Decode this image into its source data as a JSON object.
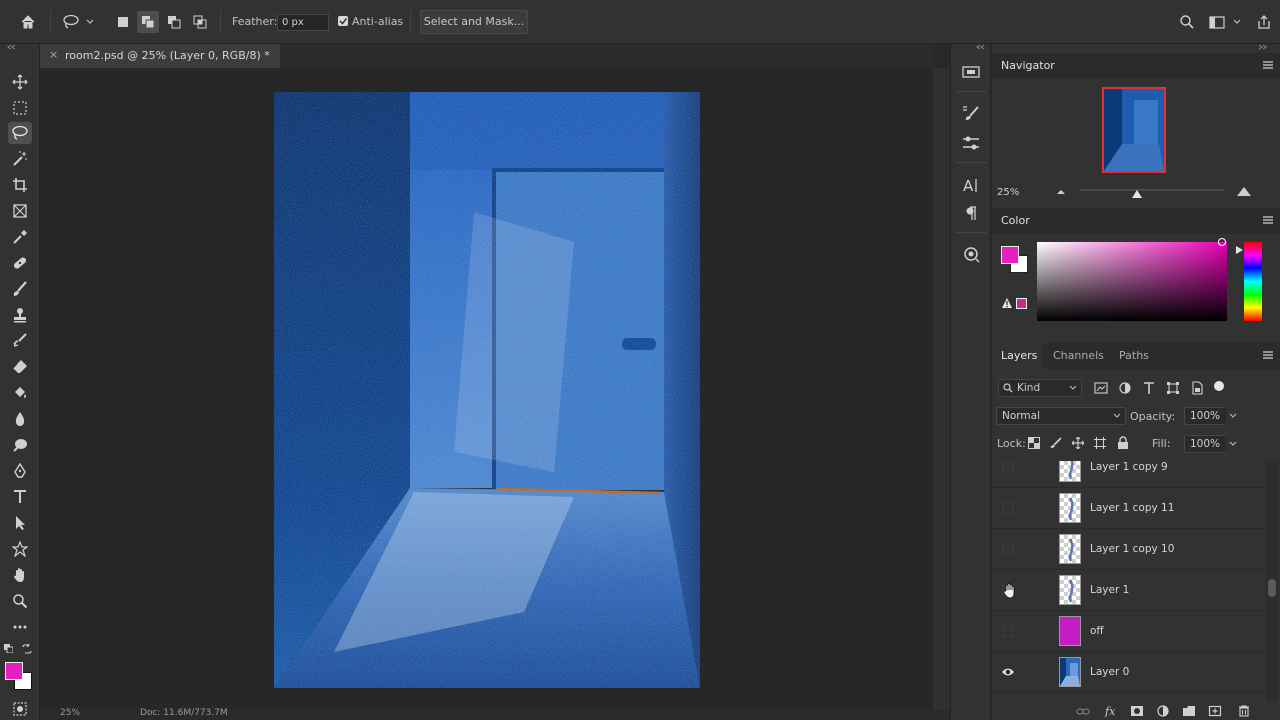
{
  "options_bar": {
    "feather_label": "Feather:",
    "feather_value": "0 px",
    "antialias_label": "Anti-alias",
    "select_mask_label": "Select and Mask..."
  },
  "document": {
    "tab_title": "room2.psd @ 25% (Layer 0, RGB/8) *",
    "close_glyph": "×",
    "status_zoom": "25%",
    "status_doc": "Doc: 11.6M/773.7M"
  },
  "navigator": {
    "title": "Navigator",
    "zoom": "25%"
  },
  "color": {
    "title": "Color",
    "foreground": "#e81fbf",
    "background": "#ffffff",
    "hue": "#e700b5"
  },
  "layers_panel": {
    "tabs": [
      "Layers",
      "Channels",
      "Paths"
    ],
    "filter_kind": "Kind",
    "blend_mode": "Normal",
    "opacity_label": "Opacity:",
    "opacity_value": "100%",
    "lock_label": "Lock:",
    "fill_label": "Fill:",
    "fill_value": "100%",
    "layers": [
      {
        "name": "Layer 1 copy 9",
        "visible": false,
        "thumb": "checker"
      },
      {
        "name": "Layer 1 copy 11",
        "visible": false,
        "thumb": "checker"
      },
      {
        "name": "Layer 1 copy 10",
        "visible": false,
        "thumb": "checker"
      },
      {
        "name": "Layer 1",
        "visible": false,
        "thumb": "checker"
      },
      {
        "name": "off",
        "visible": false,
        "thumb": "#c21ec4"
      },
      {
        "name": "Layer 0",
        "visible": true,
        "thumb": "room"
      }
    ]
  }
}
